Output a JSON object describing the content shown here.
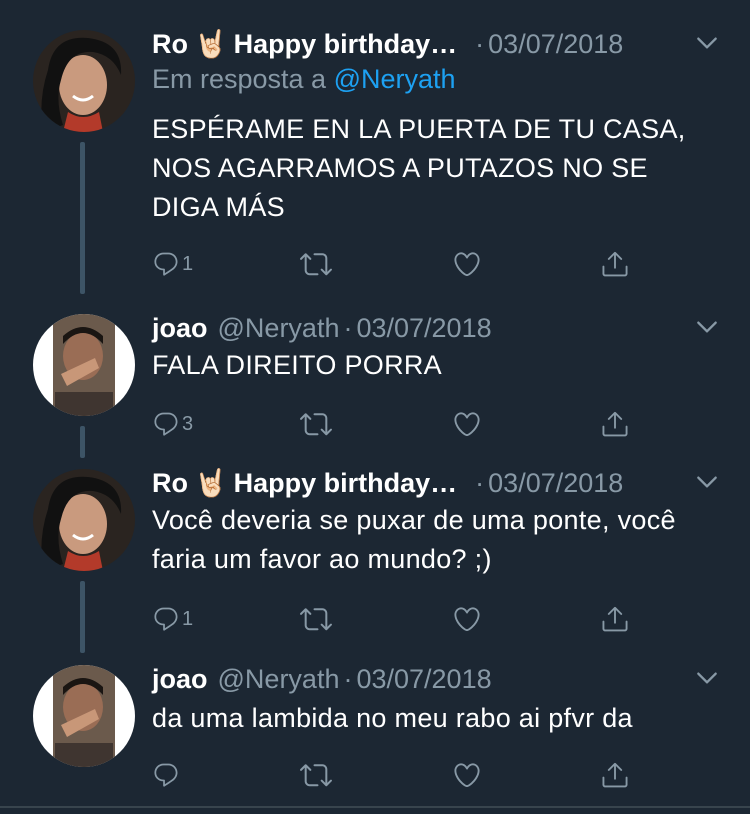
{
  "tweets": [
    {
      "name": "Ro",
      "name_suffix": "Happy birthday…",
      "date": "03/07/2018",
      "reply_prefix": "Em resposta a",
      "reply_mention": "@Neryath",
      "text": "ESPÉRAME EN LA PUERTA DE TU CASA, NOS AGARRAMOS A PUTAZOS NO SE DIGA MÁS",
      "reply_count": "1"
    },
    {
      "name": "joao",
      "handle": "@Neryath",
      "date": "03/07/2018",
      "text": "FALA DIREITO PORRA",
      "reply_count": "3"
    },
    {
      "name": "Ro",
      "name_suffix": "Happy birthday…",
      "date": "03/07/2018",
      "text": "Você deveria se puxar de uma ponte, você faria um favor ao mundo? ;)",
      "reply_count": "1"
    },
    {
      "name": "joao",
      "handle": "@Neryath",
      "date": "03/07/2018",
      "text": "da uma lambida no meu rabo ai pfvr da",
      "reply_count": ""
    }
  ],
  "icons": {
    "reply": "reply-icon",
    "retweet": "retweet-icon",
    "like": "heart-icon",
    "share": "share-icon",
    "more": "chevron-down-icon",
    "emoji": "🤘🏻"
  },
  "colors": {
    "background": "#1c2733",
    "secondary_text": "#8899a6",
    "link": "#1da1f2",
    "thread_line": "#3d5466"
  }
}
